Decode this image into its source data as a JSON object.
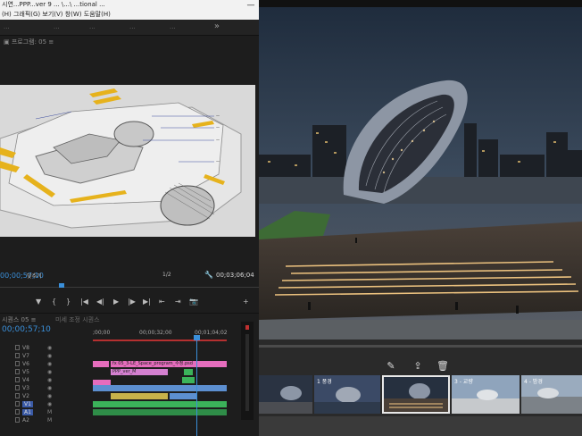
{
  "premiere": {
    "title_line1": "시연...PPP...ver 9 ... \\...\\ ...tional ...",
    "title_line2": "(H) 그래픽(G) 보기(V) 창(W) 도움말(H)",
    "minimize": "—",
    "tabs": [
      "...",
      "...",
      "...",
      "...",
      "..."
    ],
    "more": "»",
    "program_tab": "▣ 프로그램: 05 ≡",
    "program": {
      "timecode": "00;00;57;10",
      "fit": "맞추기",
      "resolution": "1/2",
      "duration": "00;03;06;04",
      "transport": [
        "▼",
        "{",
        "}",
        "|◀",
        "◀|",
        "▶",
        "|▶",
        "▶|",
        "⇤",
        "⇥",
        "📷",
        "+"
      ]
    },
    "timeline": {
      "tab": "시퀀스 05 ≡",
      "tab2": "미세 조정 시퀀스",
      "timecode": "00;00;57;10",
      "ruler_ticks": [
        ";00;00",
        "00;00;32;00",
        "00;01;04;02"
      ],
      "tracks": [
        "V8",
        "V7",
        "V6",
        "V5",
        "V4",
        "V3",
        "V2",
        "V1",
        "A1",
        "A2"
      ],
      "clips": {
        "v6": "fx  05_3-LE_Space_program_수정.psd",
        "v5": "PPP_ver_M"
      }
    }
  },
  "viewer3d": {
    "thumbnails": [
      {
        "label": ""
      },
      {
        "label": "1 풍경"
      },
      {
        "label": ""
      },
      {
        "label": "3 - 교량"
      },
      {
        "label": "4 - 밤경"
      }
    ],
    "tools": {
      "pencil": "pencil-icon",
      "export": "export-icon",
      "delete": "trash-icon"
    }
  },
  "colors": {
    "accent_blue": "#3a8fd9",
    "clip_pink": "#e56dbd",
    "clip_green": "#3bb35a",
    "clip_blue": "#5c8fd0",
    "timeline_red": "#b53030"
  }
}
